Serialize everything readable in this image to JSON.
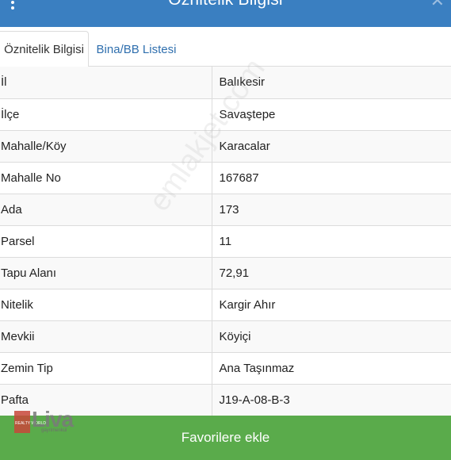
{
  "header": {
    "title": "Öznitelik Bilgisi",
    "menu_icon": "vertical-dots-icon",
    "close_icon": "close-icon",
    "close_glyph": "✕"
  },
  "tabs": [
    {
      "label": "Öznitelik Bilgisi",
      "active": true
    },
    {
      "label": "Bina/BB Listesi",
      "active": false
    }
  ],
  "attributes": [
    {
      "key": "İl",
      "value": "Balıkesir"
    },
    {
      "key": "İlçe",
      "value": "Savaştepe"
    },
    {
      "key": "Mahalle/Köy",
      "value": "Karacalar"
    },
    {
      "key": "Mahalle No",
      "value": "167687"
    },
    {
      "key": "Ada",
      "value": "173"
    },
    {
      "key": "Parsel",
      "value": "11"
    },
    {
      "key": "Tapu Alanı",
      "value": "72,91"
    },
    {
      "key": "Nitelik",
      "value": "Kargir Ahır"
    },
    {
      "key": "Mevkii",
      "value": "Köyiçi"
    },
    {
      "key": "Zemin Tip",
      "value": "Ana Taşınmaz"
    },
    {
      "key": "Pafta",
      "value": "J19-A-08-B-3"
    }
  ],
  "favorite_button": {
    "label": "Favorilere ekle"
  },
  "watermark": {
    "text": "emlakjet.com"
  },
  "logo": {
    "word": "Liva",
    "mark_text": "REALTY WORLD",
    "sub": "gayrimenkul"
  },
  "colors": {
    "header": "#3a7fc1",
    "tab_link": "#2f6fae",
    "favorite": "#5aab4b"
  }
}
